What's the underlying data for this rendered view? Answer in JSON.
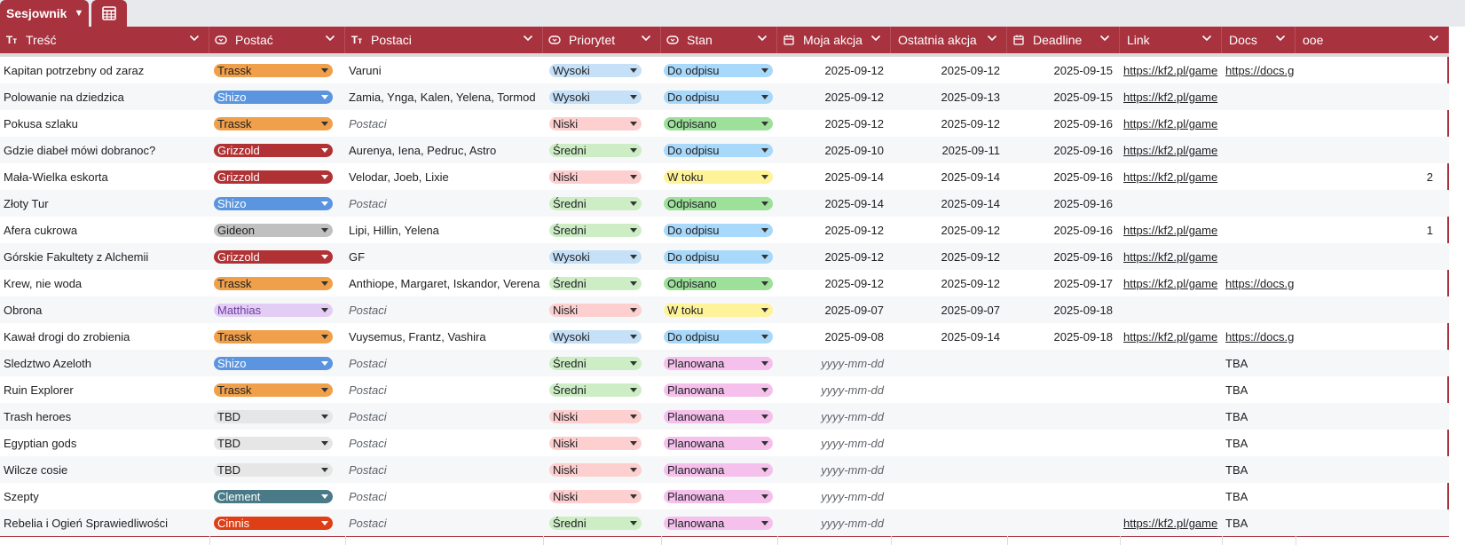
{
  "tab": {
    "name": "Sesjownik"
  },
  "icons": {
    "tab_chevron": "chevron-down-icon",
    "add_view": "calendar-grid-icon"
  },
  "columns": [
    {
      "key": "tresc",
      "label": "Treść",
      "icon": "Tт"
    },
    {
      "key": "postac",
      "label": "Postać",
      "icon": "select"
    },
    {
      "key": "postaci",
      "label": "Postaci",
      "icon": "Tт"
    },
    {
      "key": "priorytet",
      "label": "Priorytet",
      "icon": "select"
    },
    {
      "key": "stan",
      "label": "Stan",
      "icon": "select"
    },
    {
      "key": "moja",
      "label": "Moja akcja",
      "icon": "calendar"
    },
    {
      "key": "ostatnia",
      "label": "Ostatnia akcja",
      "icon": ""
    },
    {
      "key": "deadline",
      "label": "Deadline",
      "icon": "calendar"
    },
    {
      "key": "link",
      "label": "Link",
      "icon": ""
    },
    {
      "key": "docs",
      "label": "Docs",
      "icon": ""
    },
    {
      "key": "ooe",
      "label": "ooe",
      "icon": ""
    }
  ],
  "colors": {
    "Trassk": "#f0a04b",
    "Shizo": "#5b95e0",
    "Grizzold": "#b03234",
    "Gideon": "#c0c0c0",
    "Matthias": "#e3cdf4",
    "TBD": "#e6e6e6",
    "Clement": "#4a7a87",
    "Cinnis": "#de3f16",
    "Wysoki": "#c5e0f7",
    "Niski": "#fdcfcf",
    "Średni": "#cdeec5",
    "Do odpisu": "#a8d8fa",
    "Odpisano": "#9de09a",
    "W toku": "#fff39a",
    "Planowana": "#f6c0ec"
  },
  "light_text": [
    "Shizo",
    "Grizzold",
    "Clement",
    "Cinnis"
  ],
  "rows": [
    {
      "tresc": "Kapitan potrzebny od zaraz",
      "postac": "Trassk",
      "postaci": "Varuni",
      "priorytet": "Wysoki",
      "stan": "Do odpisu",
      "moja": "2025-09-12",
      "ostatnia": "2025-09-12",
      "deadline": "2025-09-15",
      "link": "https://kf2.pl/game",
      "docs": "https://docs.g",
      "ooe": ""
    },
    {
      "tresc": "Polowanie na dziedzica",
      "postac": "Shizo",
      "postaci": "Zamia, Ynga, Kalen, Yelena, Tormod",
      "priorytet": "Wysoki",
      "stan": "Do odpisu",
      "moja": "2025-09-12",
      "ostatnia": "2025-09-13",
      "deadline": "2025-09-15",
      "link": "https://kf2.pl/game",
      "docs": "",
      "ooe": ""
    },
    {
      "tresc": "Pokusa szlaku",
      "postac": "Trassk",
      "postaci": "",
      "priorytet": "Niski",
      "stan": "Odpisano",
      "moja": "2025-09-12",
      "ostatnia": "2025-09-12",
      "deadline": "2025-09-16",
      "link": "https://kf2.pl/game",
      "docs": "",
      "ooe": ""
    },
    {
      "tresc": "Gdzie diabeł mówi dobranoc?",
      "postac": "Grizzold",
      "postaci": "Aurenya, Iena, Pedruc, Astro",
      "priorytet": "Średni",
      "stan": "Do odpisu",
      "moja": "2025-09-10",
      "ostatnia": "2025-09-11",
      "deadline": "2025-09-16",
      "link": "https://kf2.pl/game",
      "docs": "",
      "ooe": ""
    },
    {
      "tresc": "Mała-Wielka eskorta",
      "postac": "Grizzold",
      "postaci": "Velodar, Joeb, Lixie",
      "priorytet": "Niski",
      "stan": "W toku",
      "moja": "2025-09-14",
      "ostatnia": "2025-09-14",
      "deadline": "2025-09-16",
      "link": "https://kf2.pl/game",
      "docs": "",
      "ooe": "2"
    },
    {
      "tresc": "Złoty Tur",
      "postac": "Shizo",
      "postaci": "",
      "priorytet": "Średni",
      "stan": "Odpisano",
      "moja": "2025-09-14",
      "ostatnia": "2025-09-14",
      "deadline": "2025-09-16",
      "link": "",
      "docs": "",
      "ooe": ""
    },
    {
      "tresc": "Afera cukrowa",
      "postac": "Gideon",
      "postaci": "Lipi, Hillin, Yelena",
      "priorytet": "Średni",
      "stan": "Do odpisu",
      "moja": "2025-09-12",
      "ostatnia": "2025-09-12",
      "deadline": "2025-09-16",
      "link": "https://kf2.pl/game",
      "docs": "",
      "ooe": "1"
    },
    {
      "tresc": "Górskie Fakultety z Alchemii",
      "postac": "Grizzold",
      "postaci": "GF",
      "priorytet": "Wysoki",
      "stan": "Do odpisu",
      "moja": "2025-09-12",
      "ostatnia": "2025-09-12",
      "deadline": "2025-09-16",
      "link": "https://kf2.pl/game",
      "docs": "",
      "ooe": ""
    },
    {
      "tresc": "Krew, nie woda",
      "postac": "Trassk",
      "postaci": "Anthiope, Margaret, Iskandor, Verena",
      "priorytet": "Średni",
      "stan": "Odpisano",
      "moja": "2025-09-12",
      "ostatnia": "2025-09-12",
      "deadline": "2025-09-17",
      "link": "https://kf2.pl/game",
      "docs": "https://docs.g",
      "ooe": ""
    },
    {
      "tresc": "Obrona",
      "postac": "Matthias",
      "postaci": "",
      "priorytet": "Niski",
      "stan": "W toku",
      "moja": "2025-09-07",
      "ostatnia": "2025-09-07",
      "deadline": "2025-09-18",
      "link": "",
      "docs": "",
      "ooe": ""
    },
    {
      "tresc": "Kawał drogi do zrobienia",
      "postac": "Trassk",
      "postaci": "Vuysemus, Frantz, Vashira",
      "priorytet": "Wysoki",
      "stan": "Do odpisu",
      "moja": "2025-09-08",
      "ostatnia": "2025-09-14",
      "deadline": "2025-09-18",
      "link": "https://kf2.pl/game",
      "docs": "https://docs.g",
      "ooe": ""
    },
    {
      "tresc": "Sledztwo Azeloth",
      "postac": "Shizo",
      "postaci": "",
      "priorytet": "Średni",
      "stan": "Planowana",
      "moja": "",
      "ostatnia": "",
      "deadline": "",
      "link": "",
      "docs": "TBA",
      "ooe": ""
    },
    {
      "tresc": "Ruin Explorer",
      "postac": "Trassk",
      "postaci": "",
      "priorytet": "Średni",
      "stan": "Planowana",
      "moja": "",
      "ostatnia": "",
      "deadline": "",
      "link": "",
      "docs": "TBA",
      "ooe": ""
    },
    {
      "tresc": "Trash heroes",
      "postac": "TBD",
      "postaci": "",
      "priorytet": "Niski",
      "stan": "Planowana",
      "moja": "",
      "ostatnia": "",
      "deadline": "",
      "link": "",
      "docs": "TBA",
      "ooe": ""
    },
    {
      "tresc": "Egyptian gods",
      "postac": "TBD",
      "postaci": "",
      "priorytet": "Niski",
      "stan": "Planowana",
      "moja": "",
      "ostatnia": "",
      "deadline": "",
      "link": "",
      "docs": "TBA",
      "ooe": ""
    },
    {
      "tresc": "Wilcze cosie",
      "postac": "TBD",
      "postaci": "",
      "priorytet": "Niski",
      "stan": "Planowana",
      "moja": "",
      "ostatnia": "",
      "deadline": "",
      "link": "",
      "docs": "TBA",
      "ooe": ""
    },
    {
      "tresc": "Szepty",
      "postac": "Clement",
      "postaci": "",
      "priorytet": "Niski",
      "stan": "Planowana",
      "moja": "",
      "ostatnia": "",
      "deadline": "",
      "link": "",
      "docs": "TBA",
      "ooe": ""
    },
    {
      "tresc": "Rebelia i Ogień Sprawiedliwości",
      "postac": "Cinnis",
      "postaci": "",
      "priorytet": "Średni",
      "stan": "Planowana",
      "moja": "",
      "ostatnia": "",
      "deadline": "",
      "link": "https://kf2.pl/game",
      "docs": "TBA",
      "ooe": ""
    }
  ],
  "placeholders": {
    "postaci": "Postaci",
    "date": "yyyy-mm-dd"
  }
}
